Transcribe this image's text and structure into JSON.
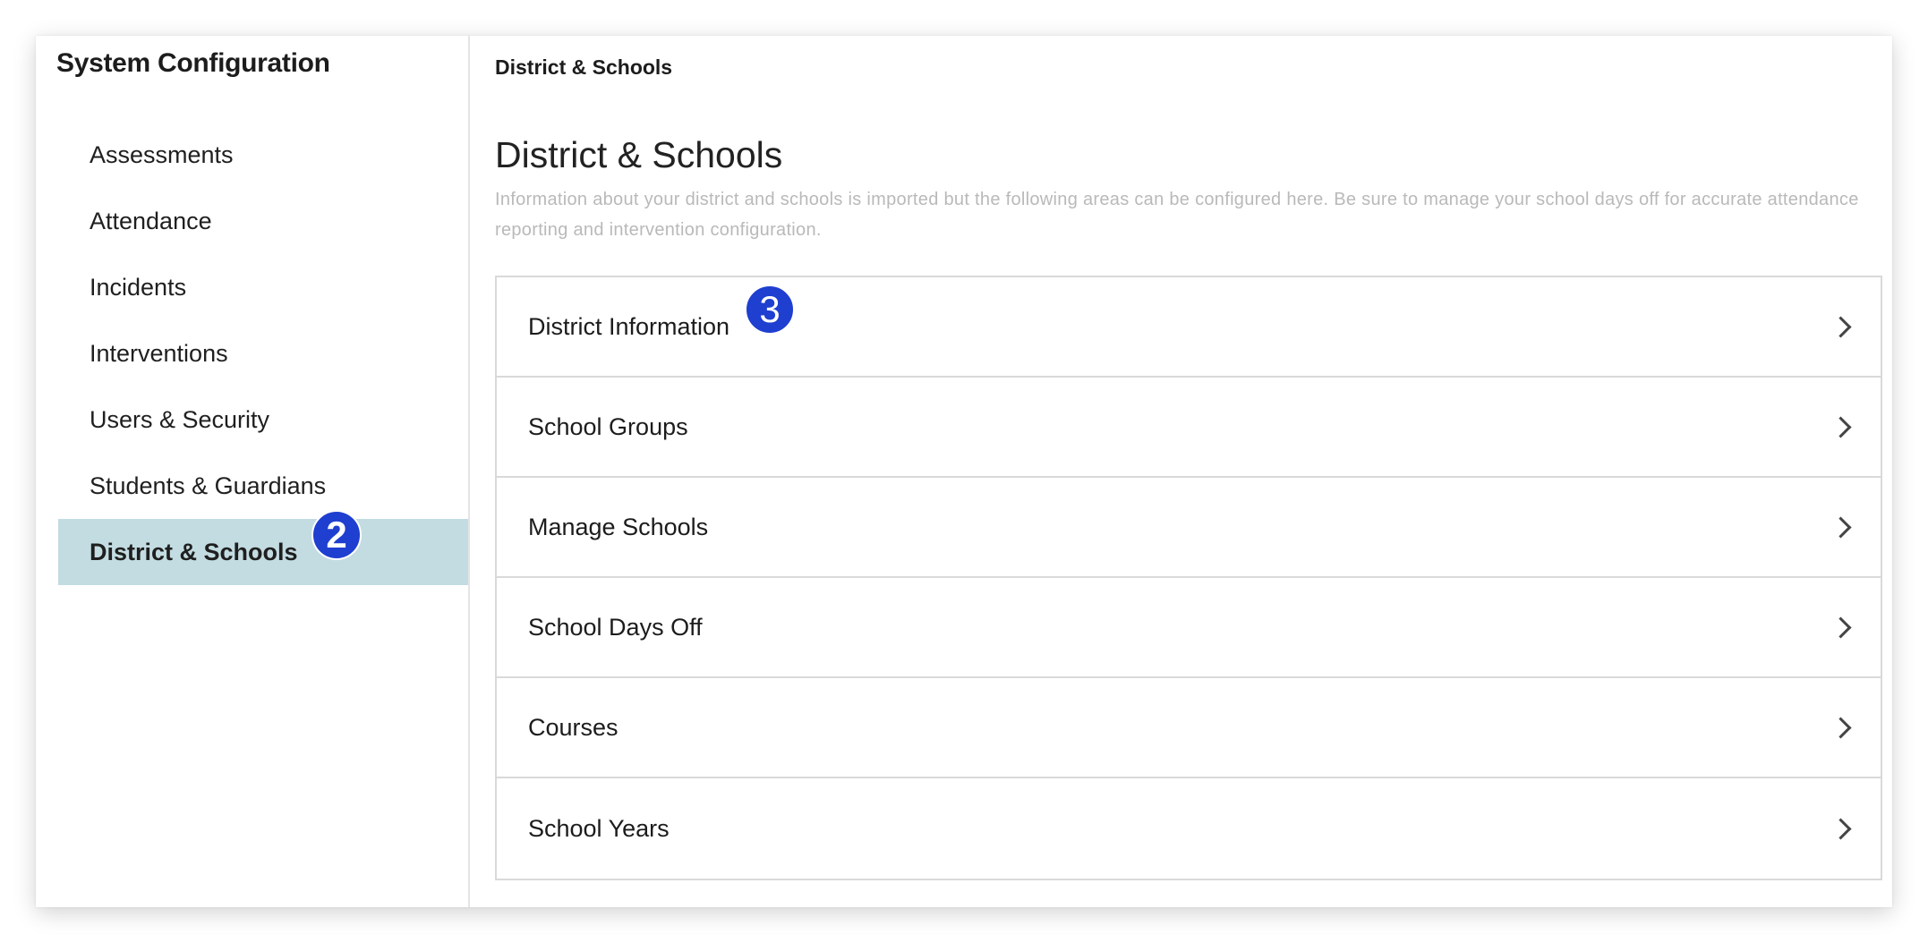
{
  "sidebar": {
    "title": "System Configuration",
    "items": [
      {
        "label": "Assessments"
      },
      {
        "label": "Attendance"
      },
      {
        "label": "Incidents"
      },
      {
        "label": "Interventions"
      },
      {
        "label": "Users & Security"
      },
      {
        "label": "Students & Guardians"
      },
      {
        "label": "District & Schools",
        "active": true
      }
    ],
    "step_badge": "2"
  },
  "main": {
    "breadcrumb": "District & Schools",
    "title": "District & Schools",
    "description": "Information about your district and schools is imported but the following areas can be configured here. Be sure to manage your school days off for accurate attendance reporting and intervention configuration.",
    "sections": [
      {
        "label": "District Information"
      },
      {
        "label": "School Groups"
      },
      {
        "label": "Manage Schools"
      },
      {
        "label": "School Days Off"
      },
      {
        "label": "Courses"
      },
      {
        "label": "School Years"
      }
    ],
    "step_badge": "3"
  },
  "icons": {
    "row_chevron": "chevron-right-icon"
  },
  "colors": {
    "active_nav_bg": "#c3dce2",
    "step_badge_bg": "#1f3fd0",
    "description_text": "#b9b9b9"
  }
}
